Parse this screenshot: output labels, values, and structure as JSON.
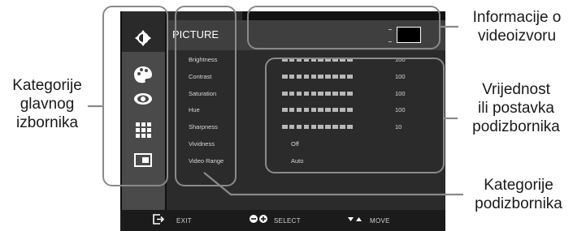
{
  "callouts": {
    "source_info": [
      "Informacije o",
      "videoizvoru"
    ],
    "main_categories": [
      "Kategorije",
      "glavnog",
      "izbornika"
    ],
    "value_setting": [
      "Vrijednost",
      "ili postavka",
      "podizbornika"
    ],
    "submenu_categories": [
      "Kategorije",
      "podizbornika"
    ]
  },
  "osd": {
    "title": "PICTURE",
    "sidebar_icons": [
      "brightness-icon",
      "palette-icon",
      "eye-icon",
      "grid-icon",
      "display-icon"
    ],
    "submenu": [
      {
        "label": "Brightness",
        "value": "100",
        "level": 1.0
      },
      {
        "label": "Contrast",
        "value": "100",
        "level": 1.0
      },
      {
        "label": "Saturation",
        "value": "100",
        "level": 1.0
      },
      {
        "label": "Hue",
        "value": "100",
        "level": 1.0
      },
      {
        "label": "Sharpness",
        "value": "10",
        "level": 1.0
      },
      {
        "label": "Vividness",
        "value": "Off"
      },
      {
        "label": "Video Range",
        "value": "Auto"
      }
    ],
    "footer": {
      "exit": "EXIT",
      "select": "SELECT",
      "move": "MOVE"
    }
  }
}
